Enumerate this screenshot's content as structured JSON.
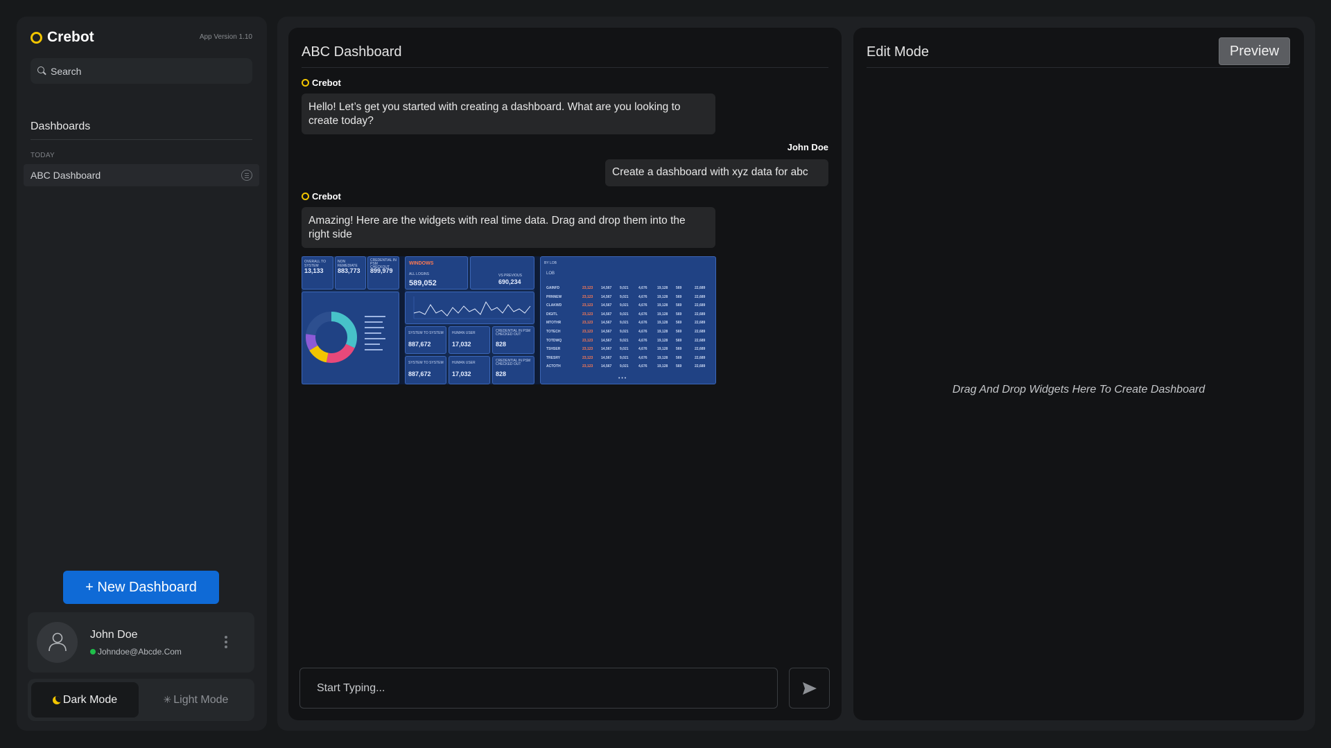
{
  "app": {
    "name": "Crebot",
    "version": "App Version 1.10",
    "accent": "#f2c500",
    "primary": "#0f6ad6"
  },
  "sidebar": {
    "search_placeholder": "Search",
    "section_title": "Dashboards",
    "group_label": "TODAY",
    "items": [
      {
        "label": "ABC Dashboard",
        "icon": "list-circle-icon"
      }
    ],
    "new_dashboard_label": "+ New Dashboard",
    "user": {
      "name": "John Doe",
      "email": "Johndoe@Abcde.Com",
      "status_color": "#1fbf4a"
    },
    "modes": {
      "dark": "Dark Mode",
      "light": "Light Mode",
      "selected": "dark"
    }
  },
  "chat": {
    "title": "ABC Dashboard",
    "messages": [
      {
        "sender": "Crebot",
        "text": "Hello! Let’s get you started with creating a dashboard. What are you looking to create today?"
      },
      {
        "sender": "John Doe",
        "text": "Create a dashboard with xyz data for abc"
      },
      {
        "sender": "Crebot",
        "text": "Amazing! Here are the widgets with real time data. Drag and drop them into the right side"
      }
    ],
    "widgets": {
      "tiles_a": [
        {
          "label": "OVERALL TO SYSTEM",
          "value": "13,133"
        },
        {
          "label": "NON REMEDIATE",
          "value": "883,773"
        },
        {
          "label": "CREDENTIAL IN PSM CHECKOUT",
          "value": "899,979"
        }
      ],
      "windows": {
        "title": "WINDOWS",
        "logins_label": "ALL LOGINS",
        "logins_value": "589,052",
        "prev_label": "VS PREVIOUS",
        "prev_value": "690,234",
        "tiles": [
          {
            "label": "SYSTEM TO SYSTEM",
            "value": "887,672"
          },
          {
            "label": "HUMAN USER",
            "value": "17,032"
          },
          {
            "label": "CREDENTIAL IN PSM CHECKED OUT",
            "value": "828"
          },
          {
            "label": "SYSTEM TO SYSTEM",
            "value": "887,672"
          },
          {
            "label": "HUMAN USER",
            "value": "17,032"
          },
          {
            "label": "CREDENTIAL IN PSM CHECKED OUT",
            "value": "828"
          }
        ]
      },
      "lob_table": {
        "title": "BY LOB",
        "header": "LOB",
        "rows": [
          "GAINFD",
          "PRNNEW",
          "CLAKWD",
          "DIGITL",
          "MTOTHR",
          "TOTECH",
          "TOTDWQ",
          "TSHSER",
          "TRESRY",
          "ACTOTH"
        ],
        "values": [
          "23,123",
          "14,567",
          "9,021",
          "4,676",
          "19,128",
          "569",
          "22,689"
        ]
      }
    },
    "input_placeholder": "Start Typing..."
  },
  "edit": {
    "title": "Edit Mode",
    "preview_label": "Preview",
    "drop_hint": "Drag And Drop Widgets Here To Create Dashboard"
  }
}
